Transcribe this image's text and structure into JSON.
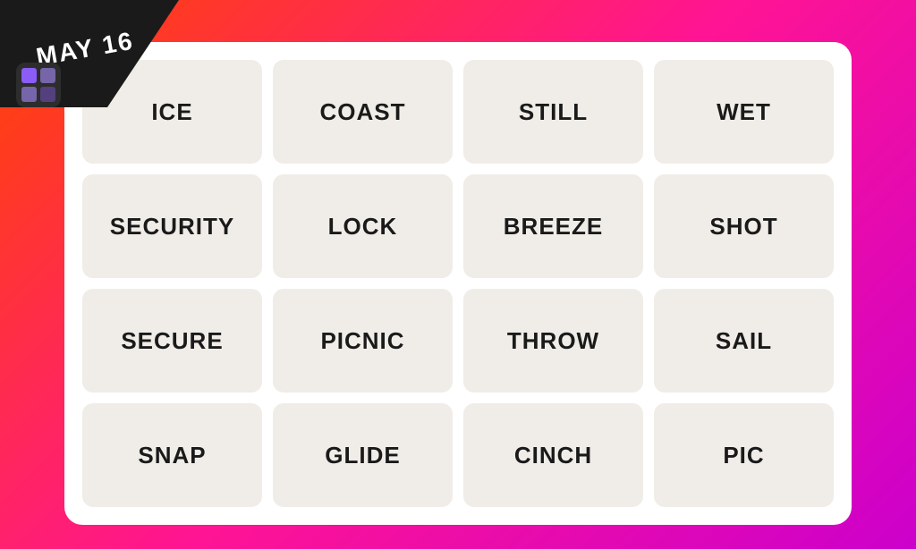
{
  "banner": {
    "date": "MAY 16"
  },
  "grid": {
    "rows": [
      [
        {
          "id": "ice",
          "label": "ICE"
        },
        {
          "id": "coast",
          "label": "COAST"
        },
        {
          "id": "still",
          "label": "STILL"
        },
        {
          "id": "wet",
          "label": "WET"
        }
      ],
      [
        {
          "id": "security",
          "label": "SECURITY"
        },
        {
          "id": "lock",
          "label": "LOCK"
        },
        {
          "id": "breeze",
          "label": "BREEZE"
        },
        {
          "id": "shot",
          "label": "SHOT"
        }
      ],
      [
        {
          "id": "secure",
          "label": "SECURE"
        },
        {
          "id": "picnic",
          "label": "PICNIC"
        },
        {
          "id": "throw",
          "label": "THROW"
        },
        {
          "id": "sail",
          "label": "SAIL"
        }
      ],
      [
        {
          "id": "snap",
          "label": "SNAP"
        },
        {
          "id": "glide",
          "label": "GLIDE"
        },
        {
          "id": "cinch",
          "label": "CINCH"
        },
        {
          "id": "pic",
          "label": "PIC"
        }
      ]
    ]
  },
  "colors": {
    "bg_gradient_start": "#ff4500",
    "bg_gradient_mid": "#ff1493",
    "bg_gradient_end": "#cc00cc",
    "tile_bg": "#f0ede8",
    "text": "#1a1a1a",
    "banner_bg": "#1a1a1a",
    "banner_text": "#ffffff"
  }
}
